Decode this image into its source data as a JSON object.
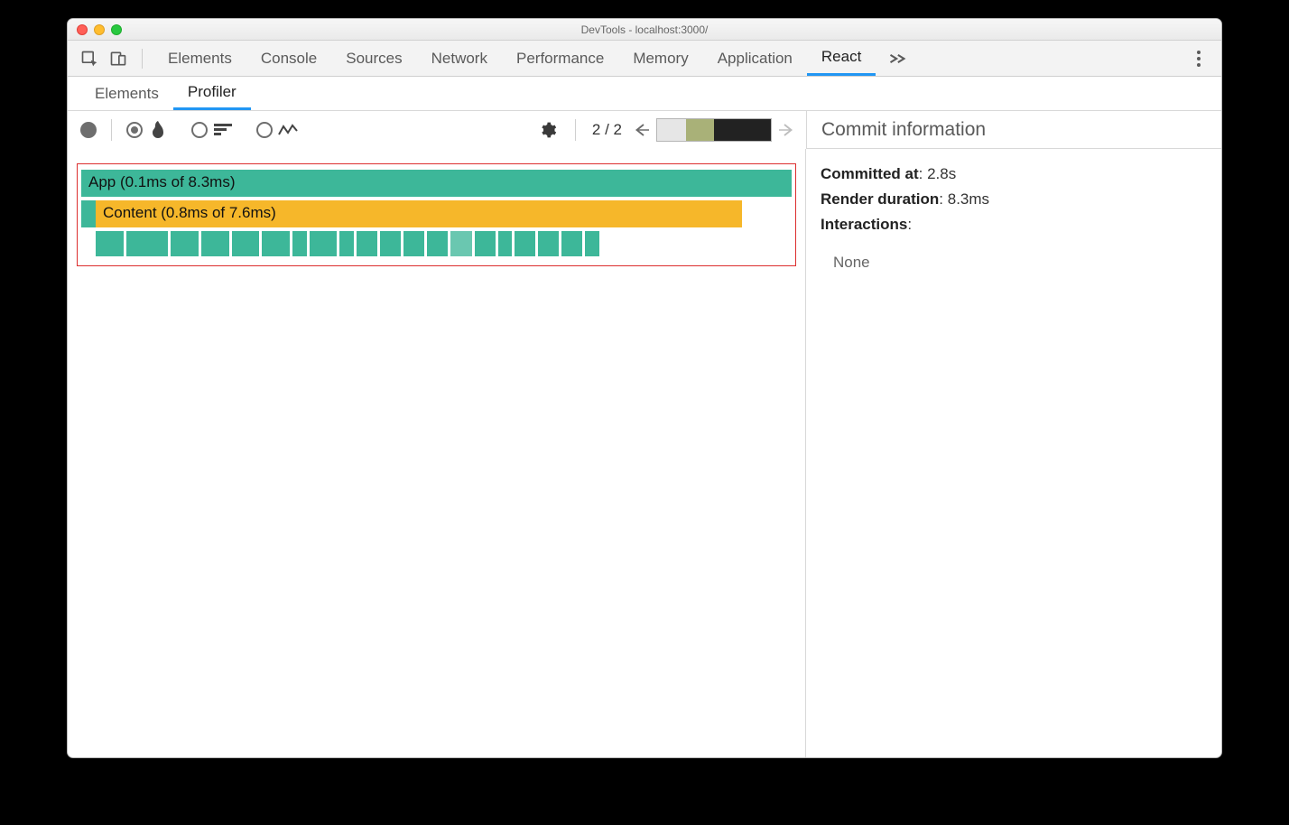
{
  "window": {
    "title": "DevTools - localhost:3000/"
  },
  "tabs": {
    "items": [
      "Elements",
      "Console",
      "Sources",
      "Network",
      "Performance",
      "Memory",
      "Application",
      "React"
    ],
    "active": "React"
  },
  "subtabs": {
    "items": [
      "Elements",
      "Profiler"
    ],
    "active": "Profiler"
  },
  "toolbar": {
    "counter": "2 / 2"
  },
  "flame": {
    "row0": {
      "label": "App (0.1ms of 8.3ms)",
      "width_pct": 100,
      "color": "teal"
    },
    "row1": {
      "indent_pct": 2,
      "label": "Content (0.8ms of 7.6ms)",
      "width_pct": 91,
      "color": "orange"
    },
    "row2_indent_pct": 2,
    "row2_leaves": [
      4,
      6,
      4,
      4,
      4,
      4,
      2,
      4,
      2,
      3,
      3,
      3,
      3,
      3,
      3,
      2,
      3,
      3,
      3,
      2
    ]
  },
  "commit_info": {
    "title": "Commit information",
    "committed_at_label": "Committed at",
    "committed_at_value": "2.8s",
    "render_duration_label": "Render duration",
    "render_duration_value": "8.3ms",
    "interactions_label": "Interactions",
    "interactions_value": "None"
  },
  "colors": {
    "teal": "#3db799",
    "orange": "#f6b72a",
    "commit_bar": [
      "#e6e6e6",
      "#a9b178",
      "#222222"
    ]
  },
  "chart_data": {
    "type": "bar",
    "title": "React Profiler flame graph — commit 2 of 2",
    "series": [
      {
        "name": "App",
        "self_ms": 0.1,
        "total_ms": 8.3,
        "depth": 0
      },
      {
        "name": "Content",
        "self_ms": 0.8,
        "total_ms": 7.6,
        "depth": 1
      }
    ],
    "leaf_count": 20,
    "commit": {
      "index": 2,
      "total": 2,
      "committed_at_s": 2.8,
      "render_duration_ms": 8.3
    }
  }
}
